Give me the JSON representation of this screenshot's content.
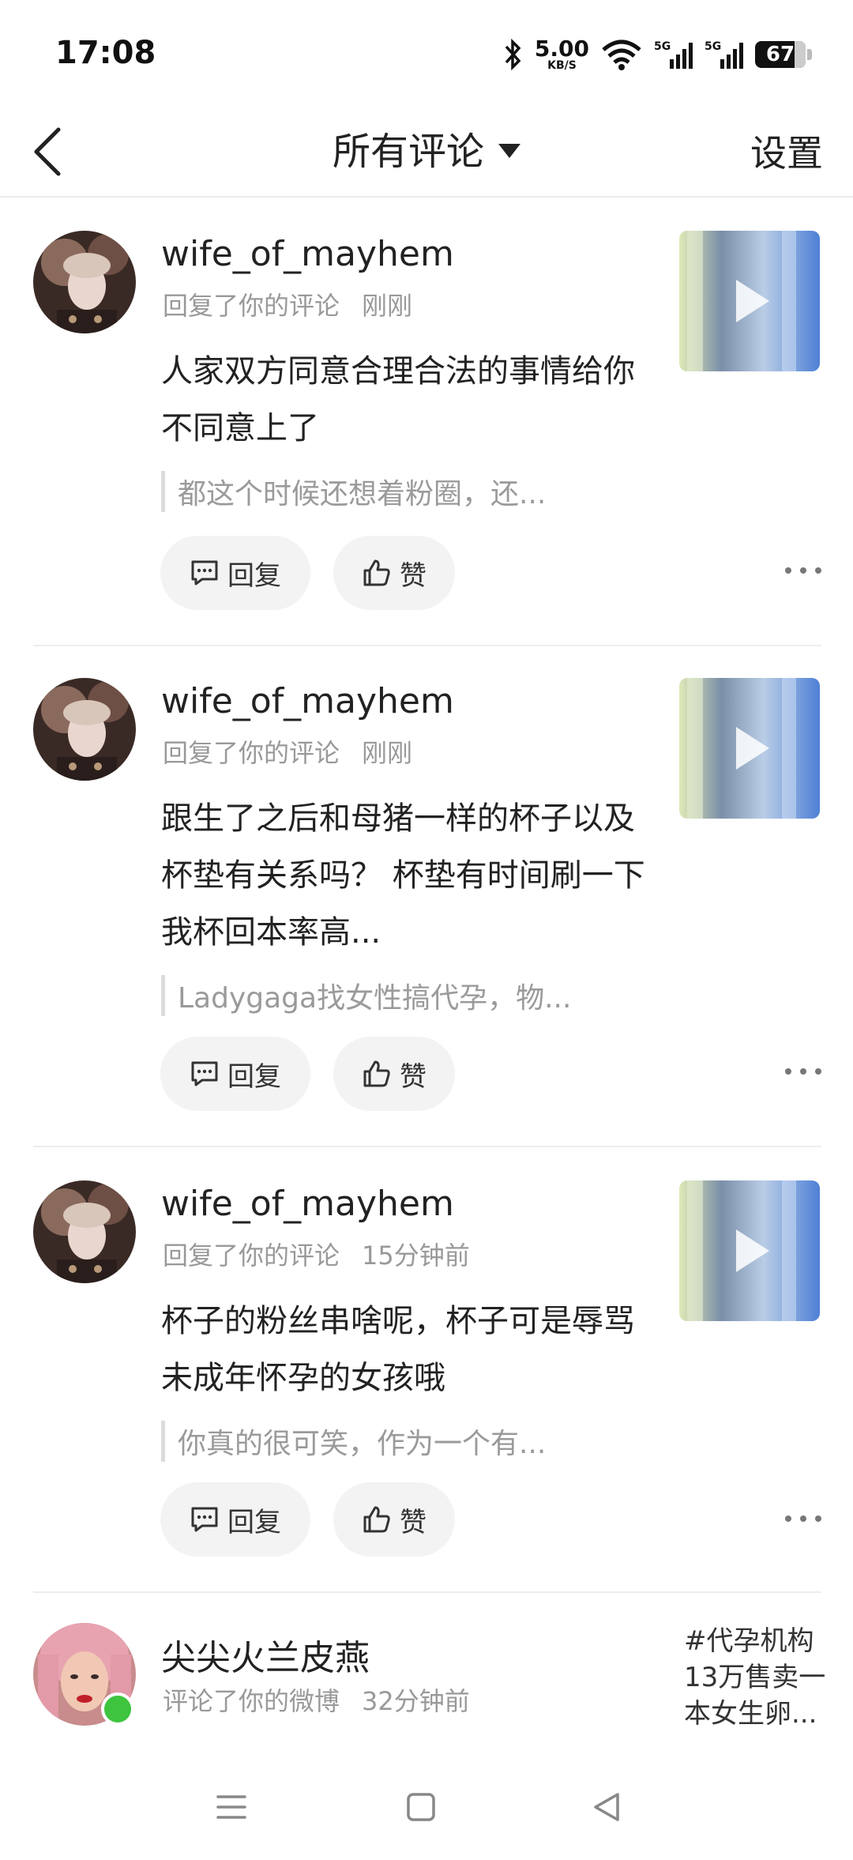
{
  "status": {
    "time": "17:08",
    "speed_value": "5.00",
    "speed_unit": "KB/S",
    "signal1": "5G",
    "signal2": "5G",
    "battery": "67"
  },
  "header": {
    "title": "所有评论",
    "settings": "设置"
  },
  "items": [
    {
      "username": "wife_of_mayhem",
      "action": "回复了你的评论",
      "time": "刚刚",
      "content": "人家双方同意合理合法的事情给你不同意上了",
      "quote": "都这个时候还想着粉圈，还...",
      "reply_label": "回复",
      "like_label": "赞"
    },
    {
      "username": "wife_of_mayhem",
      "action": "回复了你的评论",
      "time": "刚刚",
      "content": "跟生了之后和母猪一样的杯子以及杯垫有关系吗？ 杯垫有时间刷一下我杯回本率高...",
      "quote": "Ladygaga找女性搞代孕，物...",
      "reply_label": "回复",
      "like_label": "赞"
    },
    {
      "username": "wife_of_mayhem",
      "action": "回复了你的评论",
      "time": "15分钟前",
      "content": "杯子的粉丝串啥呢，杯子可是辱骂未成年怀孕的女孩哦",
      "quote": "你真的很可笑，作为一个有...",
      "reply_label": "回复",
      "like_label": "赞"
    },
    {
      "username": "尖尖火兰皮燕",
      "action": "评论了你的微博",
      "time": "32分钟前",
      "topic": "#代孕机构13万售卖一本女生卵..."
    }
  ],
  "colors": {
    "online": "#3ec43e",
    "button_bg": "#f3f3f3",
    "muted_text": "#999999"
  }
}
